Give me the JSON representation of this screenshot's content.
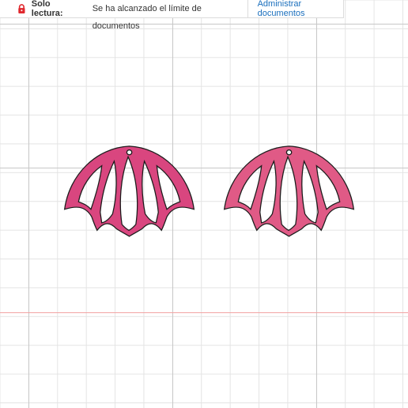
{
  "banner": {
    "readonly_label": "Solo lectura:",
    "limit_message": "Se ha alcanzado el límite de documentos",
    "manage_link": "Administrar documentos",
    "lock_icon": "lock-icon",
    "lock_color": "#e0282e",
    "link_color": "#1a6fbd"
  },
  "canvas": {
    "grid_color": "#e4e4e4",
    "major_grid_color": "#c8c8c8",
    "baseline_color": "#f2a3a3"
  },
  "earrings": [
    {
      "name": "lotus-earring-left",
      "fill": "#d9467f"
    },
    {
      "name": "lotus-earring-right",
      "fill": "#e05a86"
    }
  ]
}
